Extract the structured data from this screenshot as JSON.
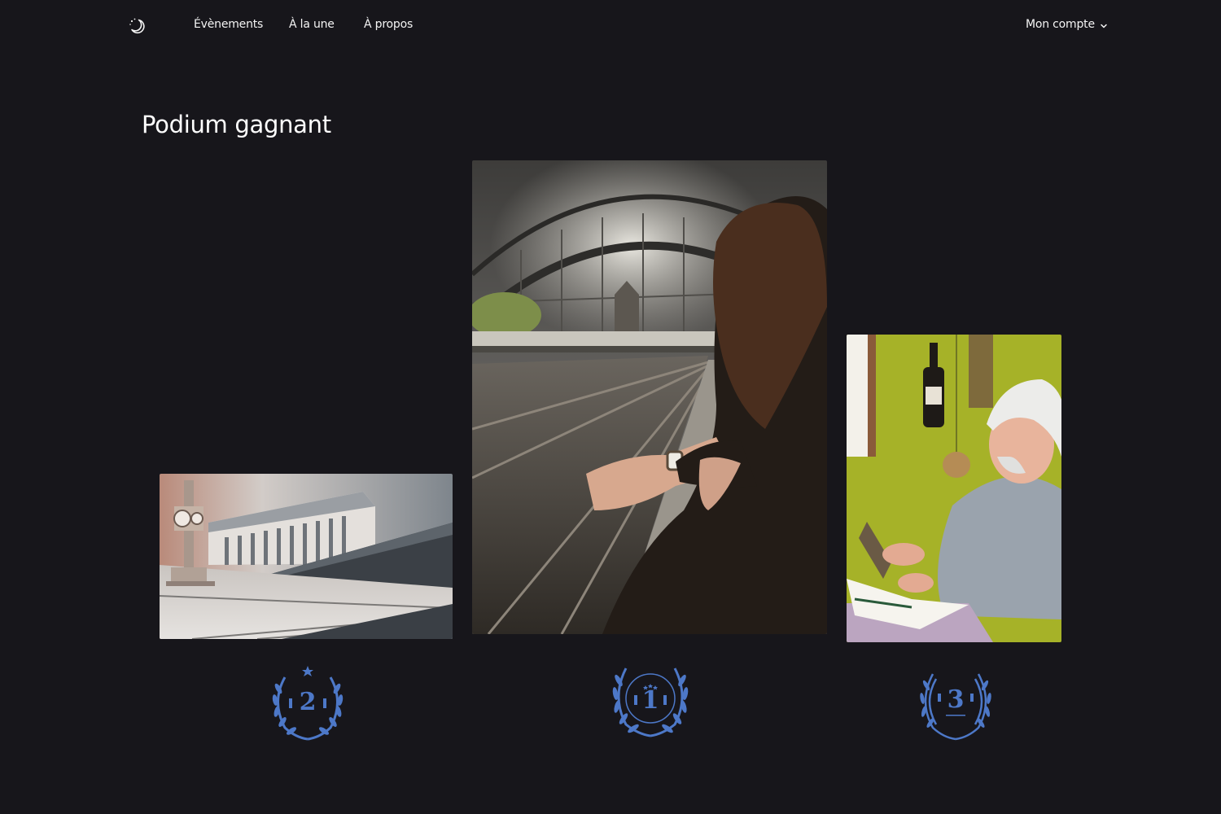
{
  "nav": {
    "logo_icon": "moon-stars-icon",
    "links": [
      "Évènements",
      "À la une",
      "À propos"
    ],
    "account_label": "Mon compte",
    "account_icon": "chevron-down-icon"
  },
  "page": {
    "title": "Podium gagnant"
  },
  "podium": [
    {
      "rank": "2",
      "image": "bordeaux-square-clock-photo"
    },
    {
      "rank": "1",
      "image": "train-station-watch-photo"
    },
    {
      "rank": "3",
      "image": "old-man-reading-photo"
    }
  ],
  "colors": {
    "background": "#17161b",
    "text": "#ffffff",
    "medal": "#4d78c8"
  }
}
